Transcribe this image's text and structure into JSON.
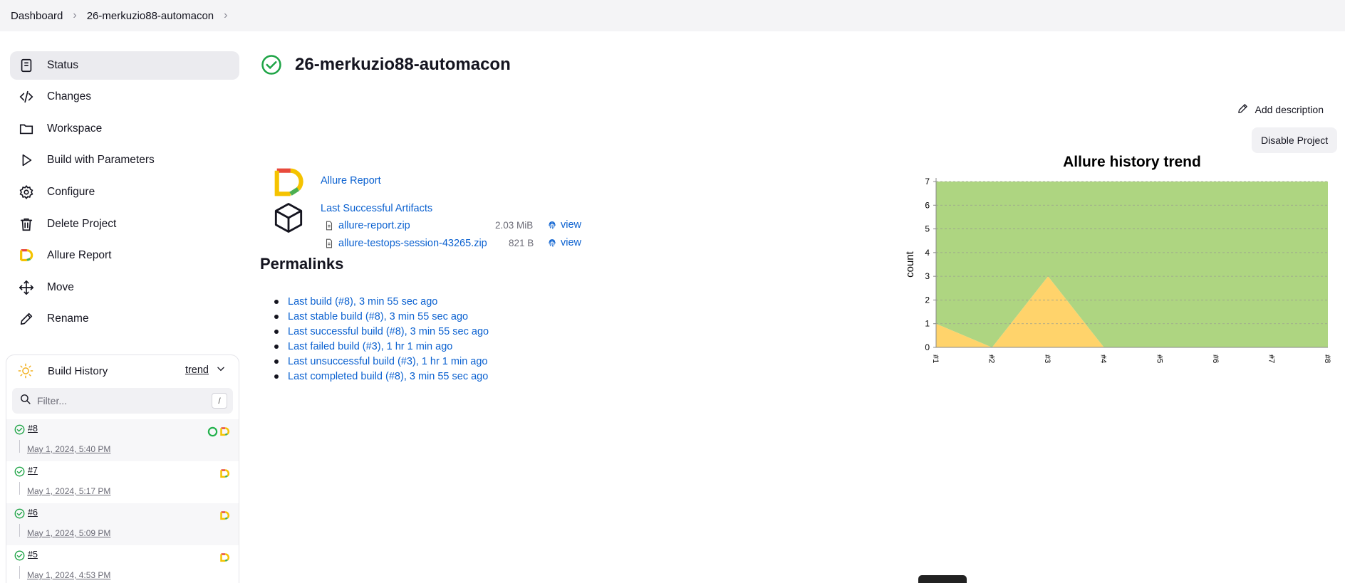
{
  "breadcrumb": {
    "items": [
      "Dashboard",
      "26-merkuzio88-automacon"
    ]
  },
  "sidebar": {
    "items": [
      {
        "label": "Status",
        "icon": "status-doc-icon"
      },
      {
        "label": "Changes",
        "icon": "code-icon"
      },
      {
        "label": "Workspace",
        "icon": "folder-icon"
      },
      {
        "label": "Build with Parameters",
        "icon": "play-icon"
      },
      {
        "label": "Configure",
        "icon": "gear-icon"
      },
      {
        "label": "Delete Project",
        "icon": "trash-icon"
      },
      {
        "label": "Allure Report",
        "icon": "allure-logo-icon"
      },
      {
        "label": "Move",
        "icon": "move-icon"
      },
      {
        "label": "Rename",
        "icon": "pencil-icon"
      }
    ]
  },
  "build_history": {
    "title": "Build History",
    "trend_label": "trend",
    "filter_placeholder": "Filter...",
    "filter_shortcut": "/",
    "builds": [
      {
        "number": "#8",
        "date": "May 1, 2024, 5:40 PM",
        "status": "success"
      },
      {
        "number": "#7",
        "date": "May 1, 2024, 5:17 PM",
        "status": "success"
      },
      {
        "number": "#6",
        "date": "May 1, 2024, 5:09 PM",
        "status": "success"
      },
      {
        "number": "#5",
        "date": "May 1, 2024, 4:53 PM",
        "status": "success"
      }
    ]
  },
  "main": {
    "title": "26-merkuzio88-automacon",
    "add_description": "Add description",
    "disable_project": "Disable Project",
    "allure_report_link": "Allure Report",
    "artifacts_link": "Last Successful Artifacts",
    "artifacts": [
      {
        "name": "allure-report.zip",
        "size": "2.03 MiB",
        "view": "view"
      },
      {
        "name": "allure-testops-session-43265.zip",
        "size": "821 B",
        "view": "view"
      }
    ],
    "permalinks_heading": "Permalinks",
    "permalinks": [
      "Last build (#8), 3 min 55 sec ago",
      "Last stable build (#8), 3 min 55 sec ago",
      "Last successful build (#8), 3 min 55 sec ago",
      "Last failed build (#3), 1 hr 1 min ago",
      "Last unsuccessful build (#3), 1 hr 1 min ago",
      "Last completed build (#8), 3 min 55 sec ago"
    ]
  },
  "colors": {
    "link": "#0b61d0",
    "success": "#1ea446",
    "passed_area": "#aed581",
    "failed_area": "#ffd36b"
  },
  "chart_data": {
    "type": "area",
    "title": "Allure history trend",
    "ylabel": "count",
    "xlabel": "",
    "x": [
      "#1",
      "#2",
      "#3",
      "#4",
      "#5",
      "#6",
      "#7",
      "#8"
    ],
    "ylim": [
      0,
      7
    ],
    "yticks": [
      0,
      1,
      2,
      3,
      4,
      5,
      6,
      7
    ],
    "grid": true,
    "stacked": true,
    "series": [
      {
        "values": [
          1,
          0,
          3,
          0,
          0,
          0,
          0,
          0
        ],
        "color": "#ffd36b"
      },
      {
        "values": [
          6,
          7,
          4,
          7,
          7,
          7,
          7,
          7
        ],
        "color": "#aed581"
      }
    ]
  }
}
